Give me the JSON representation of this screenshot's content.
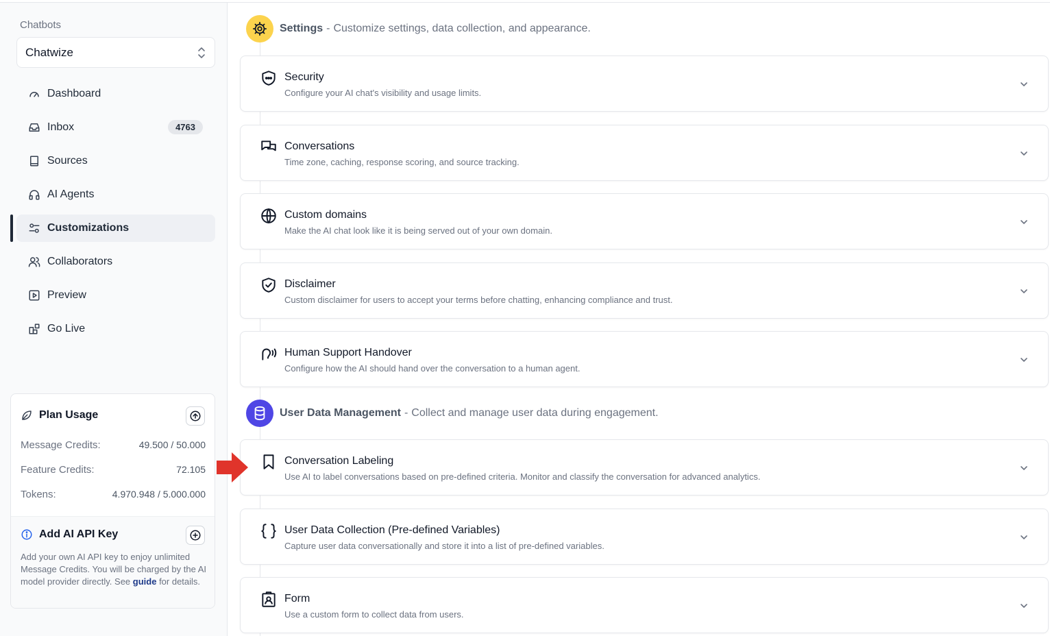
{
  "sidebar": {
    "caption": "Chatbots",
    "selected_bot": "Chatwize",
    "nav": [
      {
        "label": "Dashboard",
        "icon": "gauge-icon"
      },
      {
        "label": "Inbox",
        "icon": "inbox-icon",
        "badge": "4763"
      },
      {
        "label": "Sources",
        "icon": "book-icon"
      },
      {
        "label": "AI Agents",
        "icon": "headphones-icon"
      },
      {
        "label": "Customizations",
        "icon": "sliders-icon",
        "active": true
      },
      {
        "label": "Collaborators",
        "icon": "users-icon"
      },
      {
        "label": "Preview",
        "icon": "play-square-icon"
      },
      {
        "label": "Go Live",
        "icon": "blocks-icon"
      }
    ],
    "plan": {
      "title": "Plan Usage",
      "rows": [
        {
          "label": "Message Credits:",
          "value": "49.500 / 50.000"
        },
        {
          "label": "Feature Credits:",
          "value": "72.105"
        },
        {
          "label": "Tokens:",
          "value": "4.970.948 / 5.000.000"
        }
      ],
      "api_title": "Add AI API Key",
      "api_text_before": "Add your own AI API key to enjoy unlimited Message Credits. You will be charged by the AI model provider directly. See ",
      "api_link": "guide",
      "api_text_after": " for details."
    }
  },
  "main": {
    "settings_header": {
      "title": "Settings",
      "separator": "-",
      "desc": "Customize settings, data collection, and appearance.",
      "color": "#fcd34d"
    },
    "settings_cards": [
      {
        "title": "Security",
        "desc": "Configure your AI chat's visibility and usage limits.",
        "icon": "shield-icon"
      },
      {
        "title": "Conversations",
        "desc": "Time zone, caching, response scoring, and source tracking.",
        "icon": "messages-icon"
      },
      {
        "title": "Custom domains",
        "desc": "Make the AI chat look like it is being served out of your own domain.",
        "icon": "globe-icon"
      },
      {
        "title": "Disclaimer",
        "desc": "Custom disclaimer for users to accept your terms before chatting, enhancing compliance and trust.",
        "icon": "shield-check-icon"
      },
      {
        "title": "Human Support Handover",
        "desc": "Configure how the AI should hand over the conversation to a human agent.",
        "icon": "ear-icon"
      }
    ],
    "data_header": {
      "title": "User Data Management",
      "separator": "-",
      "desc": "Collect and manage user data during engagement.",
      "color": "#4f46e5"
    },
    "data_cards": [
      {
        "title": "Conversation Labeling",
        "desc": "Use AI to label conversations based on pre-defined criteria. Monitor and classify the conversation for advanced analytics.",
        "icon": "bookmark-icon"
      },
      {
        "title": "User Data Collection (Pre-defined Variables)",
        "desc": "Capture user data conversationally and store it into a list of pre-defined variables.",
        "icon": "braces-icon"
      },
      {
        "title": "Form",
        "desc": "Use a custom form to collect data from users.",
        "icon": "clipboard-user-icon"
      }
    ]
  },
  "accent": {
    "arrow": "#e0342b",
    "link": "#1e3a8a"
  }
}
